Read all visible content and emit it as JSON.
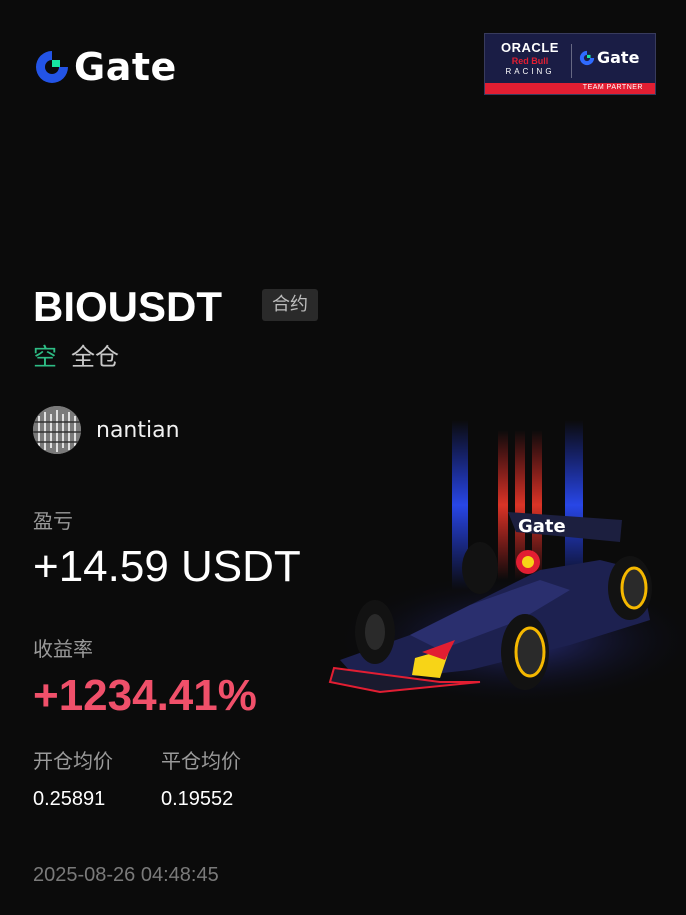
{
  "brand": {
    "name": "Gate",
    "accent": "#2354e6",
    "accent2": "#17e6a1"
  },
  "partner": {
    "line1": "ORACLE",
    "line2": "Red Bull",
    "line3": "RACING",
    "gate": "Gate",
    "tag": "TEAM PARTNER"
  },
  "position": {
    "pair": "BIOUSDT",
    "type_badge": "合约",
    "direction": "空",
    "margin_mode": "全仓",
    "direction_color": "#2ebd85"
  },
  "user": {
    "name": "nantian"
  },
  "pnl": {
    "label": "盈亏",
    "value": "+14.59 USDT"
  },
  "roi": {
    "label": "收益率",
    "value": "+1234.41%",
    "color": "#f0506a"
  },
  "prices": {
    "open_label": "开仓均价",
    "close_label": "平仓均价",
    "open_value": "0.25891",
    "close_value": "0.19552"
  },
  "timestamp": "2025-08-26 04:48:45",
  "car_livery": {
    "car_text": "Gate"
  }
}
